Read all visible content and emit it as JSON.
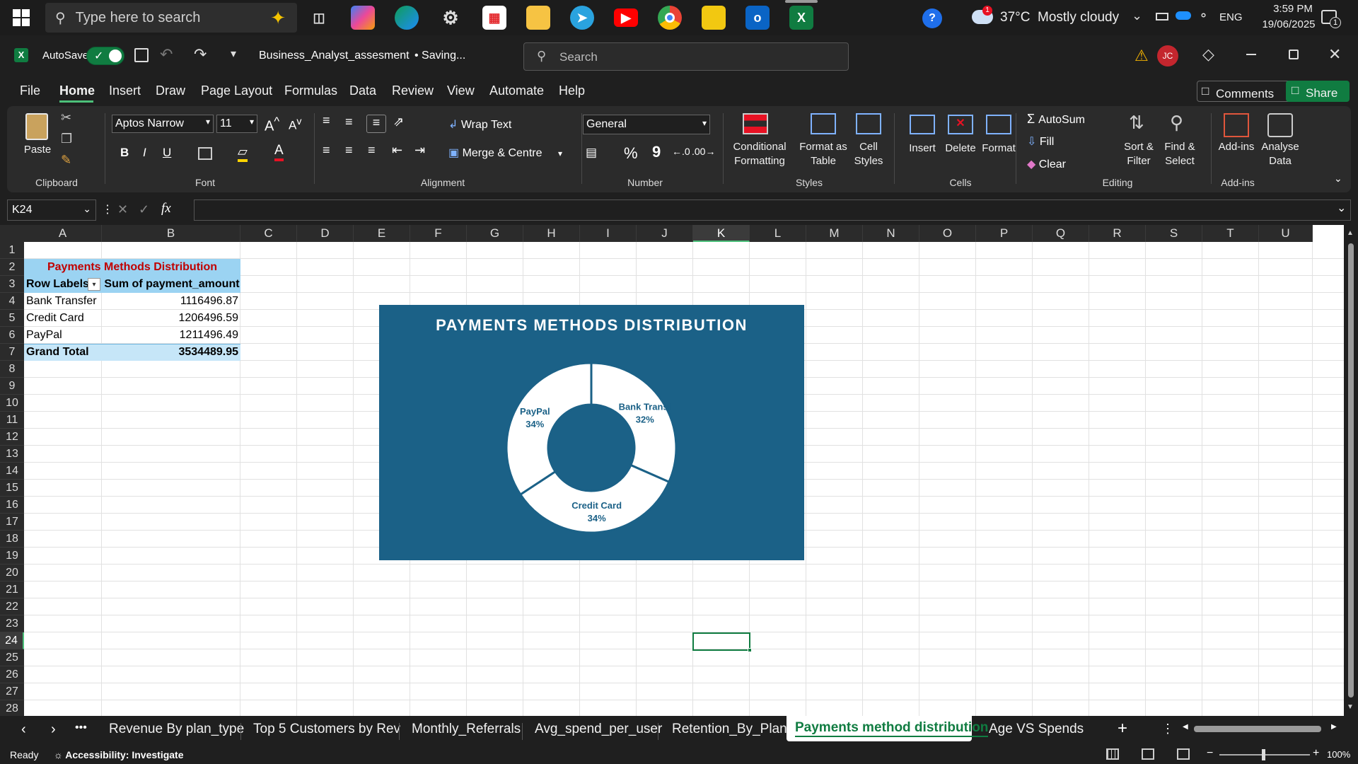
{
  "taskbar": {
    "search_placeholder": "Type here to search",
    "weather": "37°C  Mostly cloudy",
    "weather_badge": "1",
    "language": "ENG",
    "time": "3:59 PM",
    "date": "19/06/2025",
    "notification_count": "1",
    "apps": [
      "windows-icon",
      "task-view-icon",
      "copilot-icon",
      "edge-icon",
      "settings-icon",
      "store-icon",
      "file-explorer-icon",
      "telegram-icon",
      "youtube-icon",
      "chrome-icon",
      "power-bi-icon",
      "outlook-icon",
      "excel-icon"
    ]
  },
  "titlebar": {
    "autosave_label": "AutoSave",
    "filename": "Business_Analyst_assesment",
    "status": "• Saving...",
    "search_placeholder": "Search",
    "user_initials": "JC"
  },
  "menu": {
    "tabs": [
      "File",
      "Home",
      "Insert",
      "Draw",
      "Page Layout",
      "Formulas",
      "Data",
      "Review",
      "View",
      "Automate",
      "Help"
    ],
    "active": "Home",
    "comments": "Comments",
    "share": "Share"
  },
  "ribbon": {
    "clipboard": {
      "paste": "Paste",
      "group": "Clipboard"
    },
    "font": {
      "name": "Aptos Narrow",
      "size": "11",
      "group": "Font",
      "bold": "B",
      "italic": "I",
      "underline": "U"
    },
    "alignment": {
      "wrap": "Wrap Text",
      "merge": "Merge & Centre",
      "group": "Alignment"
    },
    "number": {
      "format": "General",
      "group": "Number",
      "percent": "%",
      "comma": "9"
    },
    "styles": {
      "conditional": [
        "Conditional",
        "Formatting"
      ],
      "table": [
        "Format as",
        "Table"
      ],
      "cell": [
        "Cell",
        "Styles"
      ],
      "group": "Styles"
    },
    "cells": {
      "insert": "Insert",
      "delete": "Delete",
      "format": "Format",
      "group": "Cells"
    },
    "editing": {
      "autosum": "AutoSum",
      "fill": "Fill",
      "clear": "Clear",
      "sort": [
        "Sort &",
        "Filter"
      ],
      "find": [
        "Find &",
        "Select"
      ],
      "group": "Editing"
    },
    "addins": {
      "addins": "Add-ins",
      "analyse": [
        "Analyse",
        "Data"
      ],
      "group": "Add-ins"
    }
  },
  "formula_bar": {
    "name_box": "K24",
    "fx": "fx",
    "value": ""
  },
  "columns": [
    "A",
    "B",
    "C",
    "D",
    "E",
    "F",
    "G",
    "H",
    "I",
    "J",
    "K",
    "L",
    "M",
    "N",
    "O",
    "P",
    "Q",
    "R",
    "S",
    "T",
    "U"
  ],
  "selected_column": "K",
  "rows": [
    "1",
    "2",
    "3",
    "4",
    "5",
    "6",
    "7",
    "8",
    "9",
    "10",
    "11",
    "12",
    "13",
    "14",
    "15",
    "16",
    "17",
    "18",
    "19",
    "20",
    "21",
    "22",
    "23",
    "24",
    "25",
    "26",
    "27",
    "28"
  ],
  "selected_row": "24",
  "pivot": {
    "title": "Payments Methods Distribution",
    "header_labels": "Row Labels",
    "header_sum": "Sum of payment_amount",
    "rows": [
      {
        "label": "Bank Transfer",
        "value": "1116496.87"
      },
      {
        "label": "Credit Card",
        "value": "1206496.59"
      },
      {
        "label": "PayPal",
        "value": "1211496.49"
      }
    ],
    "total_label": "Grand Total",
    "total_value": "3534489.95"
  },
  "chart_data": {
    "type": "pie",
    "title": "PAYMENTS METHODS DISTRIBUTION",
    "categories": [
      "Bank Transfer",
      "Credit Card",
      "PayPal"
    ],
    "values": [
      1116496.87,
      1206496.59,
      1211496.49
    ],
    "data_labels": [
      {
        "name": "Bank Transf",
        "pct": "32%"
      },
      {
        "name": "Credit Card",
        "pct": "34%"
      },
      {
        "name": "PayPal",
        "pct": "34%"
      }
    ],
    "donut": true,
    "colors": {
      "background": "#1b6187",
      "slice": "#ffffff",
      "label": "#1b6187"
    }
  },
  "sheet_tabs": {
    "tabs": [
      "Revenue By plan_type",
      "Top 5 Customers by Rev",
      "Monthly_Referrals",
      "Avg_spend_per_user",
      "Retention_By_Plan",
      "Payments method distribution",
      "Age VS Spends"
    ],
    "active": "Payments method distribution",
    "more": "•••"
  },
  "status": {
    "ready": "Ready",
    "accessibility": "Accessibility: Investigate",
    "zoom": "100%"
  },
  "colors": {
    "accent_green": "#107c41",
    "pivot_header": "#9bd3f2",
    "pivot_total": "#c6e6f8",
    "pivot_title": "#c00000"
  }
}
